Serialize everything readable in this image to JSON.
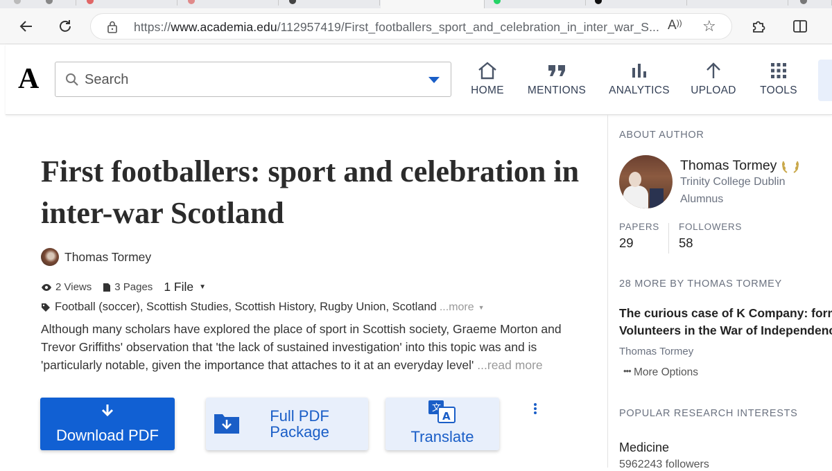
{
  "browser": {
    "url_prefix": "https://",
    "url_domain": "www.academia.edu",
    "url_path": "/112957419/First_footballers_sport_and_celebration_in_inter_war_S..."
  },
  "nav": {
    "logo": "A",
    "search_placeholder": "Search",
    "items": [
      {
        "label": "HOME",
        "icon": "home-icon"
      },
      {
        "label": "MENTIONS",
        "icon": "quote-icon"
      },
      {
        "label": "ANALYTICS",
        "icon": "bar-chart-icon"
      },
      {
        "label": "UPLOAD",
        "icon": "upload-arrow-icon"
      },
      {
        "label": "TOOLS",
        "icon": "grid-icon"
      }
    ]
  },
  "paper": {
    "title": "First footballers: sport and celebration in inter-war Scotland",
    "author": "Thomas Tormey",
    "views": "2 Views",
    "pages": "3 Pages",
    "files": "1 File",
    "tags": "Football (soccer), Scottish Studies, Scottish History, Rugby Union, Scotland",
    "tags_more": "...more",
    "abstract": "Although many scholars have explored the place of sport in Scottish society, Graeme Morton and Trevor Griffiths' observation that 'the lack of sustained investigation' into this topic was and is 'particularly notable, given the importance that attaches to it at an everyday level'",
    "read_more": "...read more"
  },
  "actions": {
    "download": "Download PDF",
    "package": "Full PDF Package",
    "translate": "Translate"
  },
  "sidebar": {
    "about_heading": "ABOUT AUTHOR",
    "author_name": "Thomas Tormey",
    "institution": "Trinity College Dublin",
    "role": "Alumnus",
    "papers_label": "PAPERS",
    "papers_value": "29",
    "followers_label": "FOLLOWERS",
    "followers_value": "58",
    "more_heading": "28 MORE BY THOMAS TORMEY",
    "more_paper_title_line1": "The curious case of K Company: former",
    "more_paper_title_line2": "Volunteers in the War of Independence",
    "more_paper_author": "Thomas Tormey",
    "more_options": "More Options",
    "interests_heading": "POPULAR RESEARCH INTERESTS",
    "interest_name": "Medicine",
    "interest_followers": "5962243 followers"
  },
  "colors": {
    "accent": "#1160d3",
    "accent_light": "#e8effb",
    "muted": "#6b7280"
  }
}
